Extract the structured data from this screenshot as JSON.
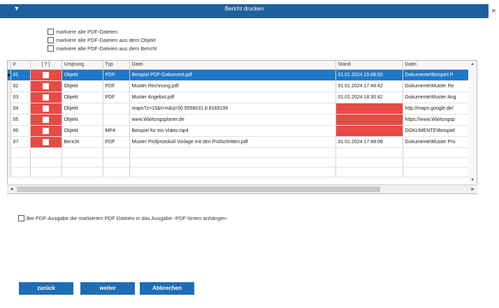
{
  "window": {
    "title": "Bericht drucken",
    "menu_icon": "triangle-down-icon",
    "close_label": "×"
  },
  "options": [
    {
      "label": "markiere alle PDF-Dateien",
      "checked": false
    },
    {
      "label": "markiere alle PDF-Dateien aus dem Objekt",
      "checked": false
    },
    {
      "label": "markiere alle PDF-Dateien aus dem Bericht",
      "checked": false
    }
  ],
  "table": {
    "columns": [
      "#",
      "[ ? ]",
      "Ursprung",
      "Typ",
      "Datei",
      "Stand",
      "Datei"
    ],
    "rows": [
      {
        "num": "01",
        "origin": "Objekt",
        "type": "PDF",
        "file": "Beispiel PDF-Dokument.pdf",
        "stand": "01.01.2024 15:08:50",
        "path": "Dokumente\\Beispiel P",
        "selected": true,
        "stand_red": false
      },
      {
        "num": "02",
        "origin": "Objekt",
        "type": "PDF",
        "file": "Muster Rechnung.pdf",
        "stand": "01.01.2024 17:48:42",
        "path": "Dokumente\\Muster Re",
        "selected": false,
        "stand_red": false
      },
      {
        "num": "03",
        "origin": "Objekt",
        "type": "PDF",
        "file": "Muster Angebot.pdf",
        "stand": "01.01.2024 18:30:42",
        "path": "Dokumente\\Muster Ang",
        "selected": false,
        "stand_red": false
      },
      {
        "num": "04",
        "origin": "Objekt",
        "type": "",
        "file": "maps?z=15&t=m&q=50.9558031,8.8168199",
        "stand": "",
        "path": "http://maps.google.de/",
        "selected": false,
        "stand_red": true
      },
      {
        "num": "05",
        "origin": "Objekt",
        "type": "",
        "file": "www.Wartungsplaner.de",
        "stand": "",
        "path": "https://www.Wartungsp",
        "selected": false,
        "stand_red": true
      },
      {
        "num": "06",
        "origin": "Objekt",
        "type": "MP4",
        "file": "Beispiel für ein Video.mp4",
        "stand": "",
        "path": "DOKUMENTE\\Beispiel",
        "selected": false,
        "stand_red": true
      },
      {
        "num": "07",
        "origin": "Bericht",
        "type": "PDF",
        "file": "Muster Prüfprotokoll Vorlage mit den Prüfschritten.pdf",
        "stand": "01.01.2024 17:48:08",
        "path": "Dokumente\\Muster Prü",
        "selected": false,
        "stand_red": false
      }
    ]
  },
  "append_option": {
    "label": "Bei PDF-Ausgabe die markierten PDF Dateien in das Ausgabe--PDF hinten anhängen",
    "checked": false
  },
  "buttons": {
    "back": "zurück",
    "next": "weiter",
    "cancel": "Abbrechen"
  },
  "colors": {
    "titlebar": "#1f5f9e",
    "selection": "#1e78c8",
    "marker_red": "#e84a45",
    "button": "#1f6db3"
  }
}
